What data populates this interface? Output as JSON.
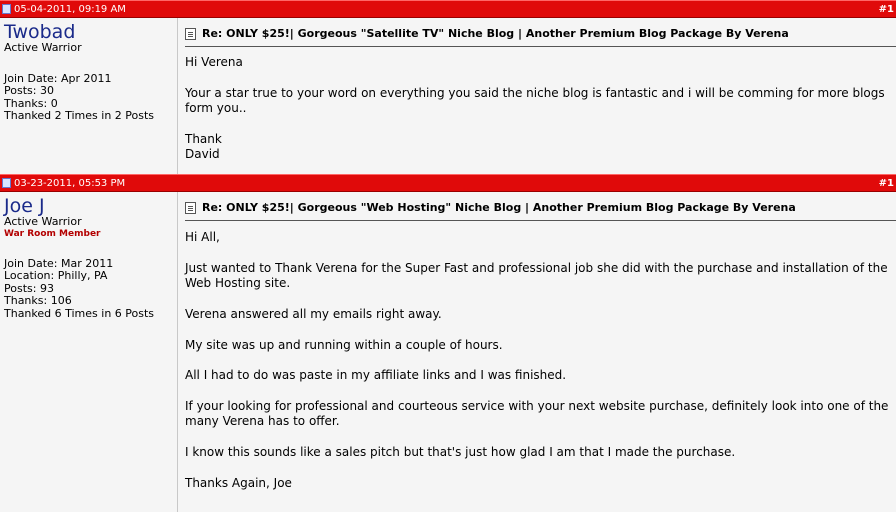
{
  "posts": [
    {
      "date": "05-04-2011, 09:19 AM",
      "post_number": "#1",
      "username": "Twobad",
      "user_title": "Active Warrior",
      "badge": "",
      "stats": [
        "Join Date: Apr 2011",
        "Posts: 30",
        "Thanks: 0",
        "Thanked 2 Times in 2 Posts"
      ],
      "subject": "Re: ONLY $25!| Gorgeous \"Satellite TV\" Niche Blog | Another Premium Blog Package By Verena",
      "paragraphs": [
        "Hi Verena",
        "Your a star true to your word on everything you said the niche blog is fantastic and i will be comming for more blogs form you..",
        "Thank\nDavid"
      ]
    },
    {
      "date": "03-23-2011, 05:53 PM",
      "post_number": "#1",
      "username": "Joe J",
      "user_title": "Active Warrior",
      "badge": "War Room Member",
      "stats": [
        "Join Date: Mar 2011",
        "Location: Philly, PA",
        "Posts: 93",
        "Thanks: 106",
        "Thanked 6 Times in 6 Posts"
      ],
      "subject": "Re: ONLY $25!| Gorgeous \"Web Hosting\" Niche Blog | Another Premium Blog Package By Verena",
      "paragraphs": [
        "Hi All,",
        "Just wanted to Thank Verena for the Super Fast and professional job she did with the purchase and installation of the Web Hosting site.",
        "Verena answered all my emails right away.",
        "My site was up and running within a couple of hours.",
        "All I had to do was paste in my affiliate links and I was finished.",
        "If your looking for professional and courteous service with your next website purchase, definitely look into one of the many Verena has to offer.",
        "I know this sounds like a sales pitch but that's just how glad I am that I made the purchase.",
        "Thanks Again, Joe"
      ]
    }
  ]
}
